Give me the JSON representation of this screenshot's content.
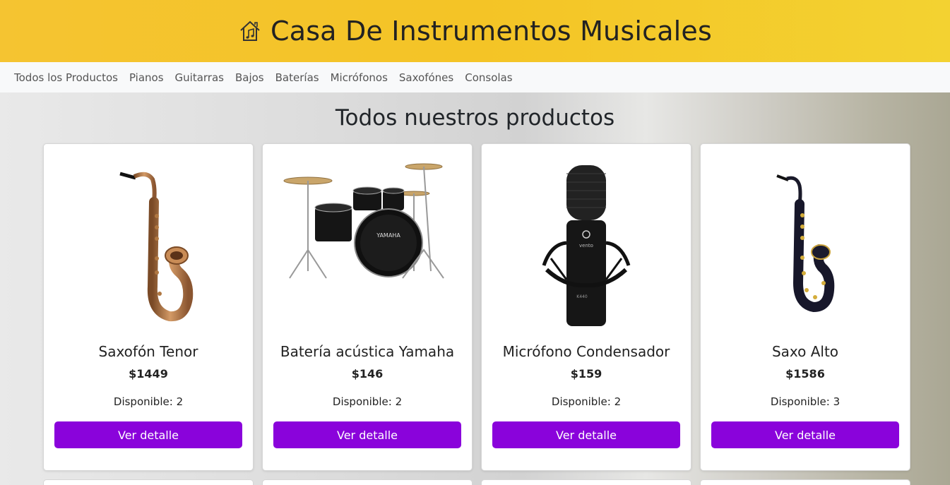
{
  "header": {
    "title": "Casa De Instrumentos Musicales",
    "icon": "home-music-icon",
    "color": "#f4c426"
  },
  "nav": {
    "items": [
      {
        "label": "Todos los Productos"
      },
      {
        "label": "Pianos"
      },
      {
        "label": "Guitarras"
      },
      {
        "label": "Bajos"
      },
      {
        "label": "Baterías"
      },
      {
        "label": "Micrófonos"
      },
      {
        "label": "Saxofónes"
      },
      {
        "label": "Consolas"
      }
    ]
  },
  "main": {
    "title": "Todos nuestros productos",
    "products": [
      {
        "name": "Saxofón Tenor",
        "price": "$1449",
        "stock_label": "Disponible:",
        "stock": "2",
        "button": "Ver detalle",
        "image": "tenor-saxophone"
      },
      {
        "name": "Batería acústica Yamaha",
        "price": "$146",
        "stock_label": "Disponible:",
        "stock": "2",
        "button": "Ver detalle",
        "image": "drum-kit"
      },
      {
        "name": "Micrófono Condensador",
        "price": "$159",
        "stock_label": "Disponible:",
        "stock": "2",
        "button": "Ver detalle",
        "image": "condenser-microphone"
      },
      {
        "name": "Saxo Alto",
        "price": "$1586",
        "stock_label": "Disponible:",
        "stock": "3",
        "button": "Ver detalle",
        "image": "alto-saxophone"
      }
    ]
  },
  "colors": {
    "button": "#8a03db",
    "header": "#f4c426"
  }
}
